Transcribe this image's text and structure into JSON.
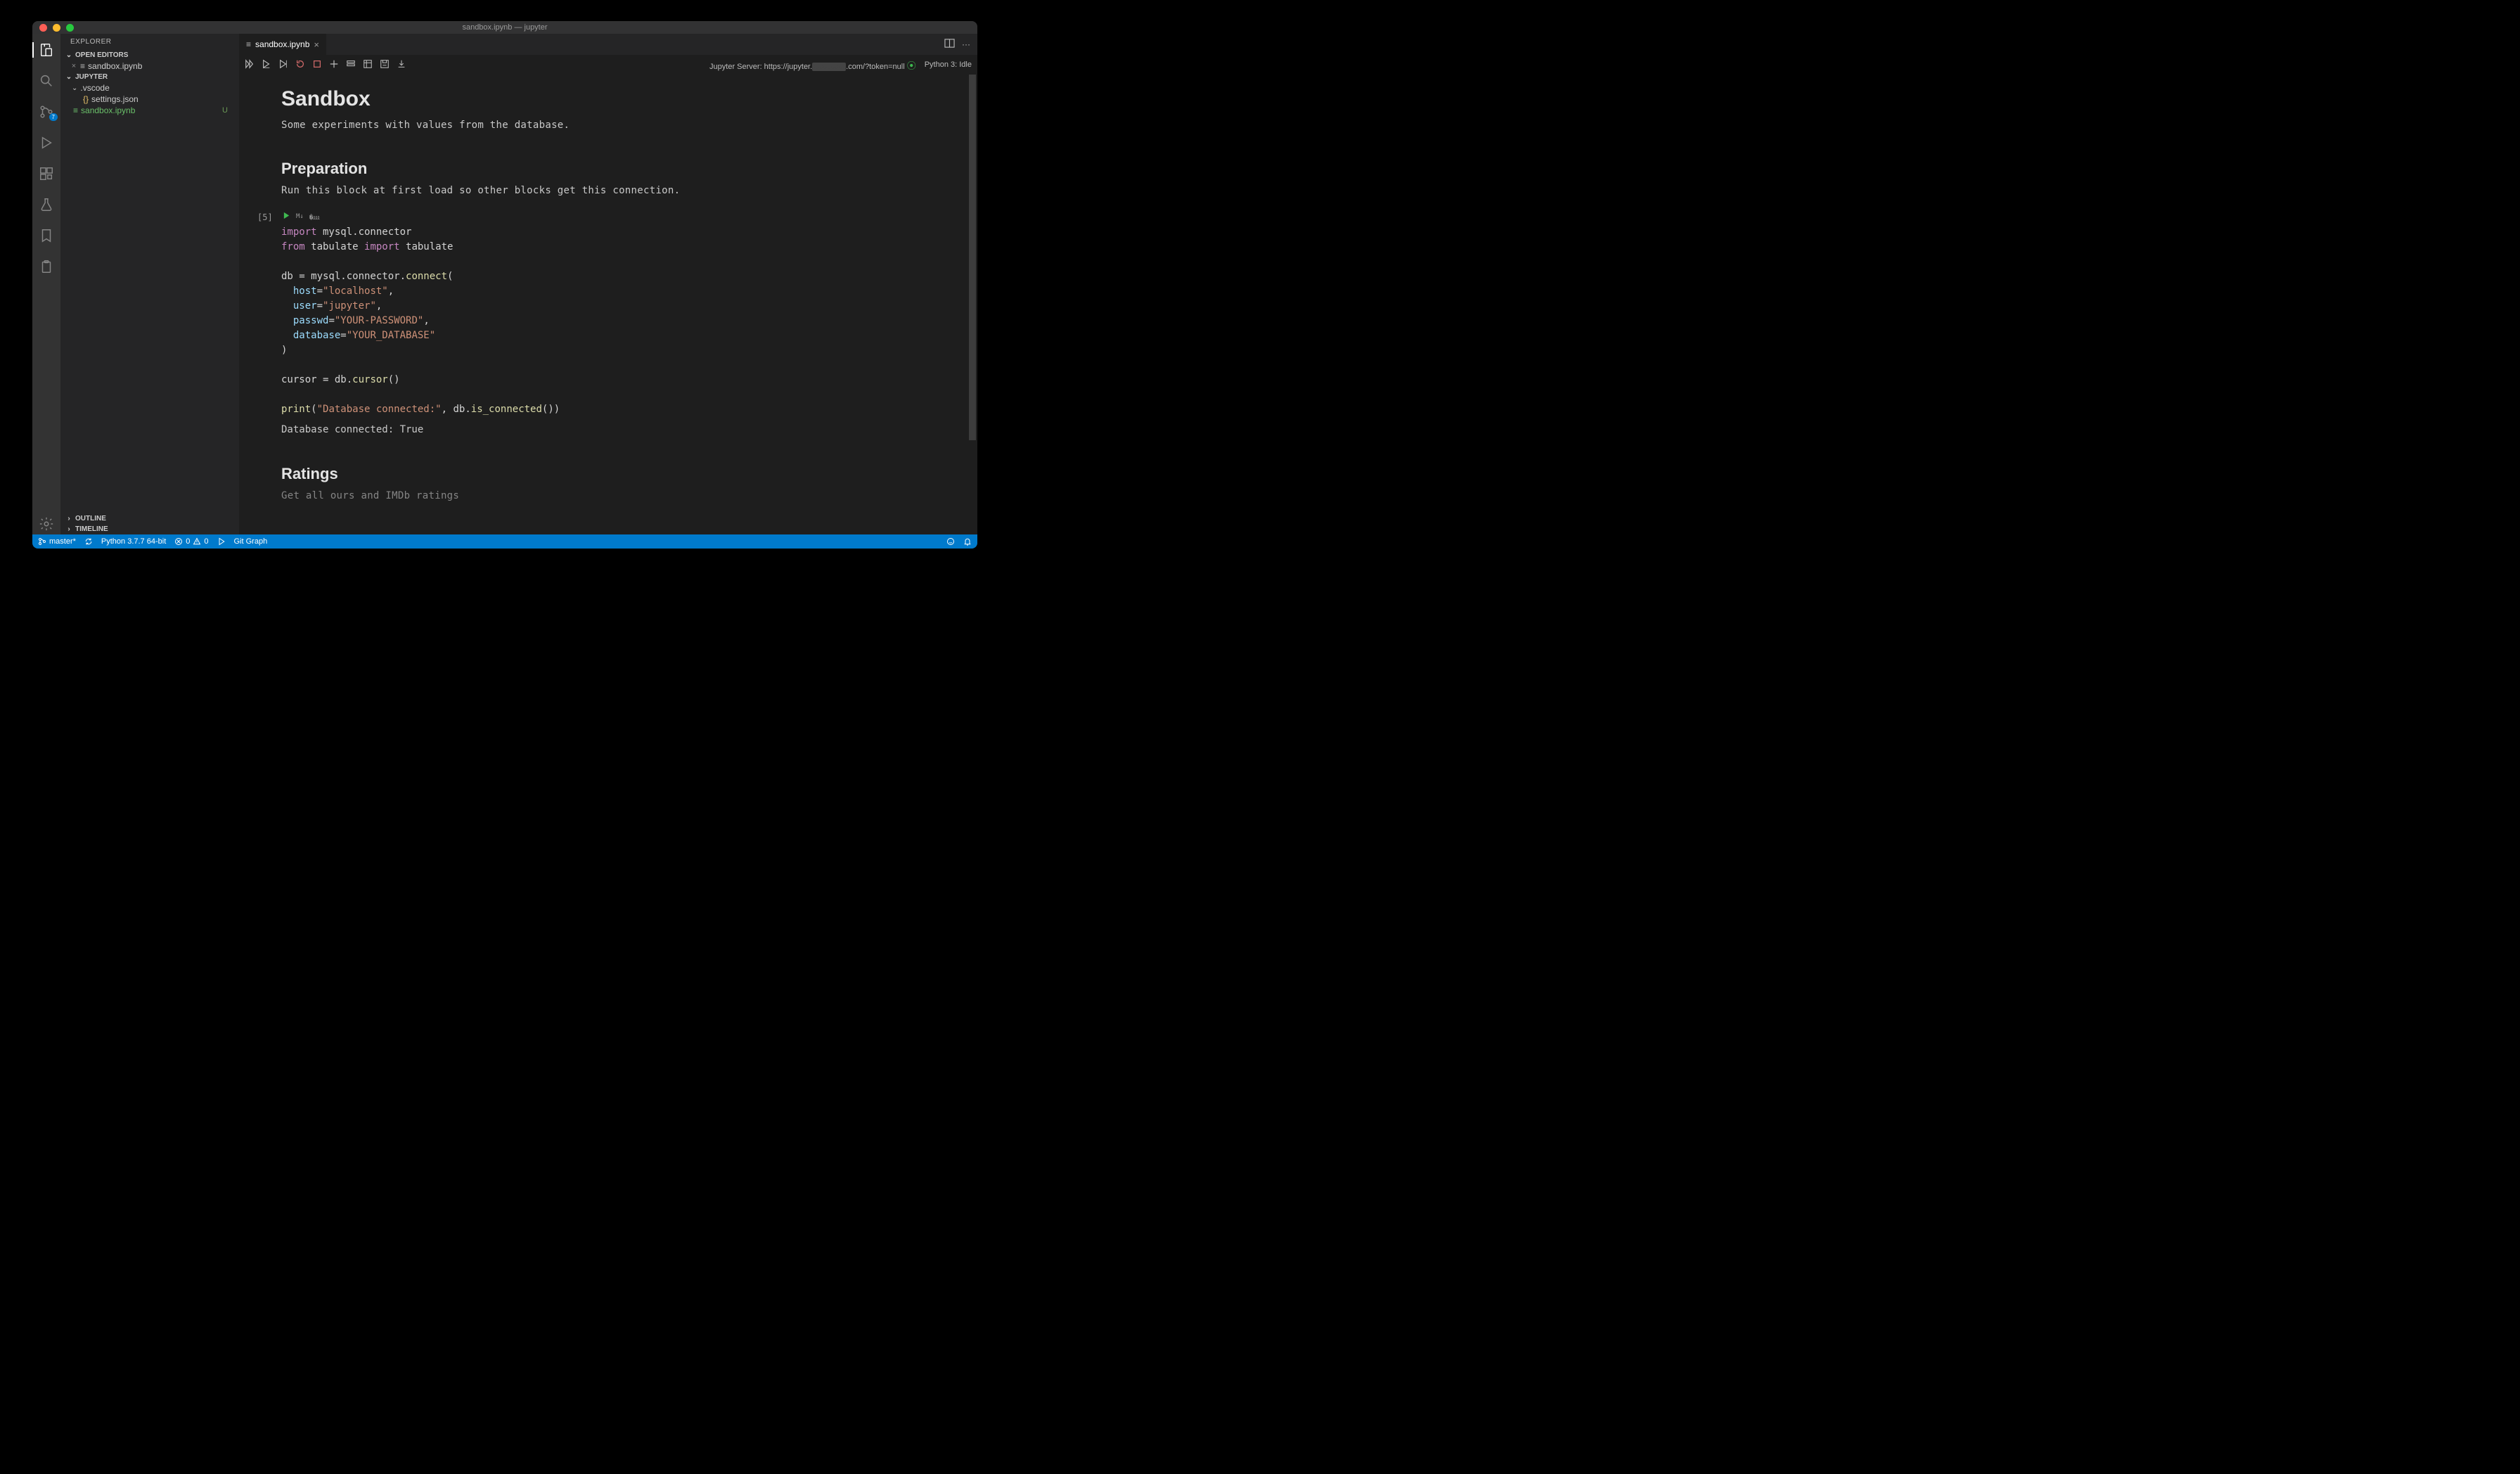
{
  "window": {
    "title": "sandbox.ipynb — jupyter"
  },
  "activitybar": {
    "scm_badge": "7"
  },
  "sidebar": {
    "header": "EXPLORER",
    "sections": {
      "open_editors": "OPEN EDITORS",
      "workspace": "JUPYTER",
      "outline": "OUTLINE",
      "timeline": "TIMELINE"
    },
    "open_editor_item": "sandbox.ipynb",
    "tree": {
      "folder_vscode": ".vscode",
      "settings_json": "settings.json",
      "sandbox_ipynb": "sandbox.ipynb",
      "sandbox_status": "U"
    }
  },
  "tabs": {
    "active": "sandbox.ipynb"
  },
  "notebook_toolbar": {
    "server_label": "Jupyter Server: https://jupyter.",
    "server_suffix": ".com/?token=null",
    "kernel_label": "Python 3: Idle"
  },
  "notebook": {
    "h1": "Sandbox",
    "p1": "Some experiments with values from the database.",
    "h2a": "Preparation",
    "p2": "Run this block at first load so other blocks get this connection.",
    "cell1": {
      "prompt": "[5]",
      "code": {
        "l1_kw": "import",
        "l1_rest": " mysql.connector",
        "l2_kw1": "from",
        "l2_mid": " tabulate ",
        "l2_kw2": "import",
        "l2_end": " tabulate",
        "l4_lhs": "db = mysql.connector.",
        "l4_fn": "connect",
        "l4_paren": "(",
        "l5_arg": "host",
        "l5_eq": "=",
        "l5_str": "\"localhost\"",
        "l5_c": ",",
        "l6_arg": "user",
        "l6_eq": "=",
        "l6_str": "\"jupyter\"",
        "l6_c": ",",
        "l7_arg": "passwd",
        "l7_eq": "=",
        "l7_str": "\"YOUR-PASSWORD\"",
        "l7_c": ",",
        "l8_arg": "database",
        "l8_eq": "=",
        "l8_str": "\"YOUR_DATABASE\"",
        "l9": ")",
        "l11_lhs": "cursor = db.",
        "l11_fn": "cursor",
        "l11_end": "()",
        "l13_fn": "print",
        "l13_open": "(",
        "l13_str": "\"Database connected:\"",
        "l13_mid": ", db.",
        "l13_fn2": "is_connected",
        "l13_end": "())"
      },
      "output": "Database connected: True"
    },
    "h2b": "Ratings",
    "p3": "Get all ours and IMDb ratings"
  },
  "statusbar": {
    "branch": "master*",
    "python": "Python 3.7.7 64-bit",
    "errors": "0",
    "warnings": "0",
    "gitgraph": "Git Graph"
  }
}
